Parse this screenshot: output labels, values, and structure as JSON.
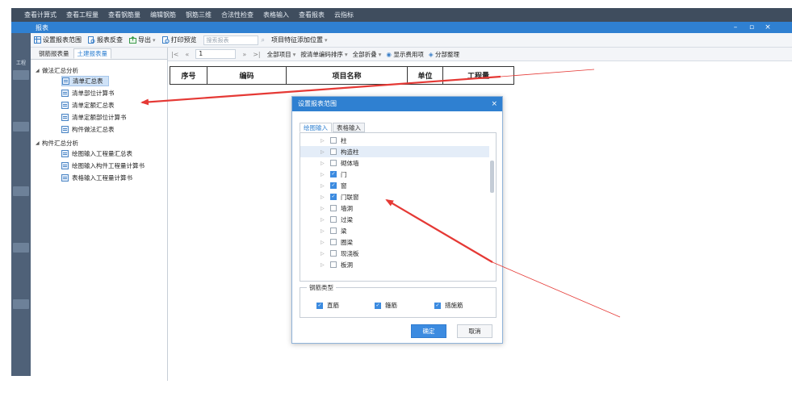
{
  "menu": [
    "查看计算式",
    "查看工程量",
    "查看钢筋量",
    "编辑钢筋",
    "钢筋三维",
    "合法性检查",
    "表格输入",
    "查看报表",
    "云指标"
  ],
  "window": {
    "title": "报表",
    "min": "–",
    "max": "▫",
    "close": "×"
  },
  "leftstrip": {
    "labels": [
      "工程"
    ]
  },
  "toolbar": {
    "set_range": "设置报表范围",
    "report_check": "报表反查",
    "export": "导出",
    "print_preview": "打印预览",
    "search_placeholder": "搜索报表",
    "add_feature": "项目特征添加位置"
  },
  "left_tabs": [
    "钢筋报表量",
    "土建报表量"
  ],
  "tree": {
    "group1": "做法汇总分析",
    "group1_items": [
      "清单汇总表",
      "清单部位计算书",
      "清单定额汇总表",
      "清单定额部位计算书",
      "构件做法汇总表"
    ],
    "group2": "构件汇总分析",
    "group2_items": [
      "绘图输入工程量汇总表",
      "绘图输入构件工程量计算书",
      "表格输入工程量计算书"
    ]
  },
  "nav": {
    "first": "|<",
    "prev": "«",
    "page": "1",
    "next": "»",
    "last": ">|",
    "all_items": "全部项目",
    "sort": "按清单编码排序",
    "fold": "全部折叠",
    "show_used": "显示费用项",
    "split": "分部整理"
  },
  "table_headers": [
    "序号",
    "编码",
    "项目名称",
    "单位",
    "工程量"
  ],
  "dialog": {
    "title": "设置报表范围",
    "close": "×",
    "tabs": [
      "绘图输入",
      "表格输入"
    ],
    "items": [
      {
        "label": "柱",
        "checked": false
      },
      {
        "label": "构造柱",
        "checked": false
      },
      {
        "label": "砌体墙",
        "checked": false
      },
      {
        "label": "门",
        "checked": true
      },
      {
        "label": "窗",
        "checked": true
      },
      {
        "label": "门联窗",
        "checked": true
      },
      {
        "label": "墙洞",
        "checked": false
      },
      {
        "label": "过梁",
        "checked": false
      },
      {
        "label": "梁",
        "checked": false
      },
      {
        "label": "圈梁",
        "checked": false
      },
      {
        "label": "现浇板",
        "checked": false
      },
      {
        "label": "板洞",
        "checked": false
      }
    ],
    "group_label": "钢筋类型",
    "group_items": [
      "直筋",
      "箍筋",
      "措施筋"
    ],
    "ok": "确定",
    "cancel": "取消"
  },
  "colors": {
    "accent": "#2f80d1",
    "arrow": "#e53935",
    "selection": "#cfe2f7"
  }
}
